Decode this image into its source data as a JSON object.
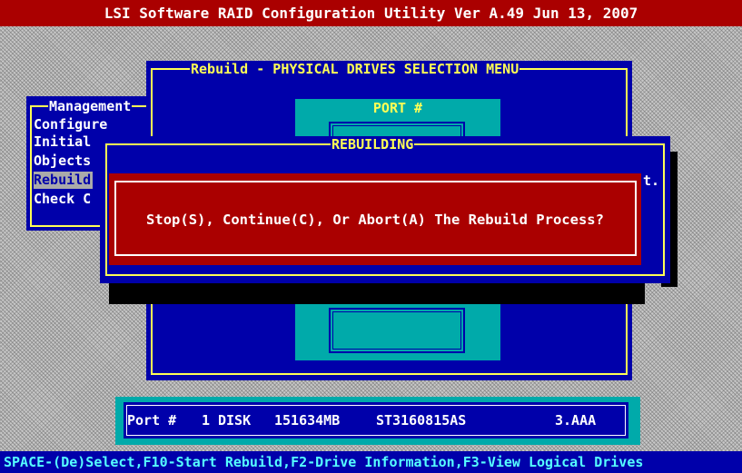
{
  "title_bar": "LSI Software RAID Configuration Utility Ver A.49 Jun 13, 2007",
  "status_bar": "SPACE-(De)Select,F10-Start Rebuild,F2-Drive Information,F3-View Logical Drives",
  "management_menu": {
    "title": "Management",
    "items": [
      "Configure",
      "Initial",
      "Objects",
      "Rebuild",
      "Check C"
    ],
    "selected": "Rebuild"
  },
  "rebuild_menu": {
    "title": "Rebuild - PHYSICAL DRIVES SELECTION MENU",
    "port_header": "PORT #"
  },
  "rebuilding_dialog": {
    "title": "REBUILDING",
    "edge_text": "t."
  },
  "confirm_dialog": {
    "message": "Stop(S), Continue(C), Or Abort(A) The Rebuild Process?"
  },
  "drive_info": {
    "port_label": "Port #",
    "port_number": "1",
    "type": "DISK",
    "size": "151634MB",
    "model": "ST3160815AS",
    "firmware": "3.AAA"
  },
  "colors": {
    "title_bg": "#aa0000",
    "dialog_blue": "#0000aa",
    "frame_yellow": "#ffff55",
    "teal": "#00aaaa",
    "status_text": "#55ffff"
  }
}
